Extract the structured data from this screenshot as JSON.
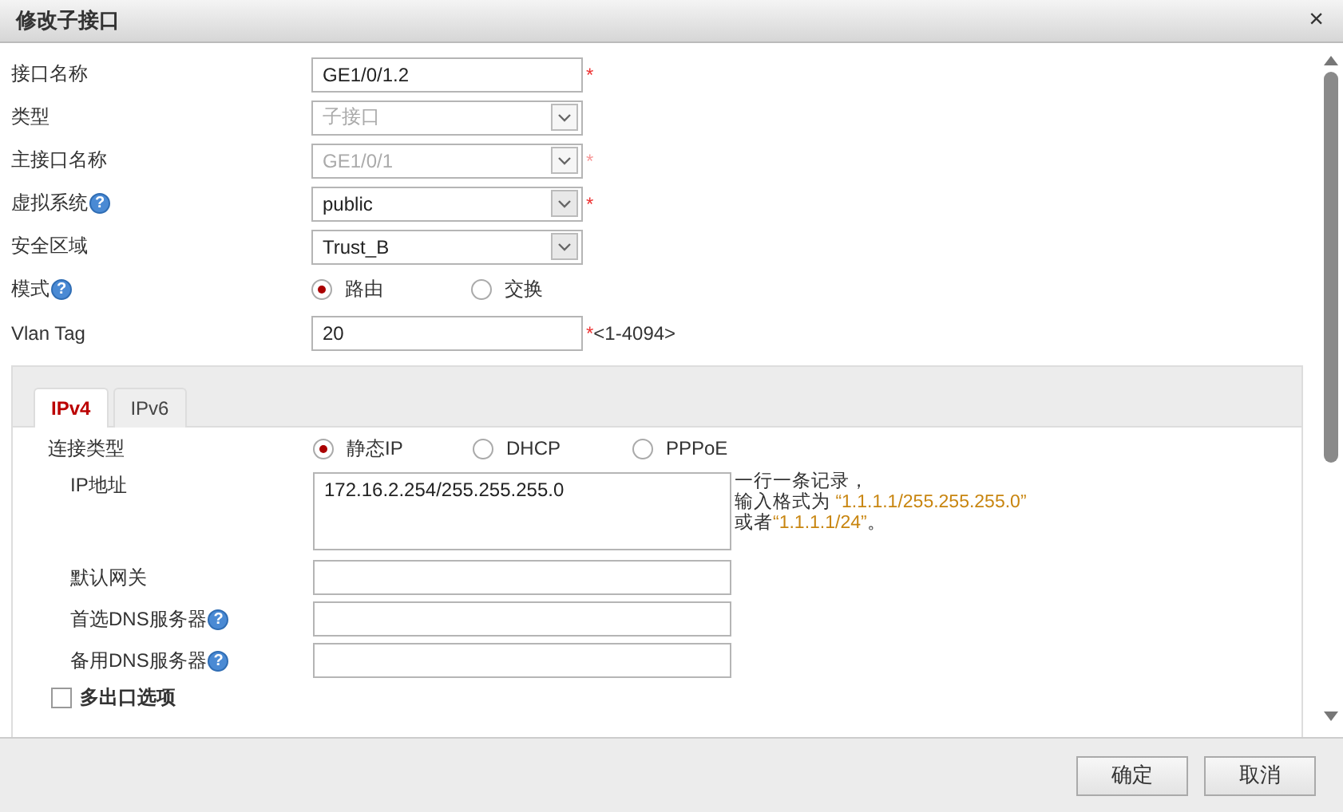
{
  "dialog": {
    "title": "修改子接口",
    "close": "×"
  },
  "fields": [
    {
      "kind": "text",
      "label": "接口名称",
      "value": "GE1/0/1.2",
      "required_mark": "*",
      "disabled": false
    },
    {
      "kind": "select",
      "label": "类型",
      "value": "子接口",
      "disabled": true
    },
    {
      "kind": "select",
      "label": "主接口名称",
      "value": "GE1/0/1",
      "required_mark": "*",
      "disabled": true
    },
    {
      "kind": "select",
      "label": "虚拟系统",
      "help_mark": "?",
      "value": "public",
      "required_mark": "*",
      "disabled": false
    },
    {
      "kind": "select",
      "label": "安全区域",
      "value": "Trust_B",
      "disabled": false
    },
    {
      "kind": "radio",
      "label": "模式",
      "help_mark": "?",
      "options": [
        {
          "label": "路由",
          "selected": true
        },
        {
          "label": "交换",
          "selected": false
        }
      ]
    },
    {
      "kind": "text",
      "label": "Vlan Tag",
      "value": "20",
      "required_mark": "*",
      "disabled": false,
      "range": "<1-4094>"
    }
  ],
  "tabs": [
    {
      "label": "IPv4",
      "selected": true
    },
    {
      "label": "IPv6",
      "selected": false
    }
  ],
  "connection": {
    "label": "连接类型",
    "options": [
      {
        "label": "静态IP",
        "selected": true
      },
      {
        "label": "DHCP",
        "selected": false
      },
      {
        "label": "PPPoE",
        "selected": false
      }
    ]
  },
  "ip_address": {
    "label": "IP地址",
    "value": "172.16.2.254/255.255.255.0",
    "hint": [
      [
        {
          "kind": "plain",
          "text": "一行一条记录，"
        }
      ],
      [
        {
          "kind": "plain",
          "text": "输入格式为 "
        },
        {
          "kind": "example",
          "text": "“1.1.1.1/255.255.255.0”"
        }
      ],
      [
        {
          "kind": "plain",
          "text": "或者"
        },
        {
          "kind": "example",
          "text": "“1.1.1.1/24”"
        },
        {
          "kind": "plain",
          "text": "。"
        }
      ]
    ]
  },
  "ipv4_fields": [
    {
      "label": "默认网关"
    },
    {
      "label": "首选DNS服务器",
      "help_mark": "?"
    },
    {
      "label": "备用DNS服务器",
      "help_mark": "?"
    }
  ],
  "option": {
    "label": "多出口选项",
    "checked": false
  },
  "buttons": [
    "确定",
    "取消"
  ]
}
